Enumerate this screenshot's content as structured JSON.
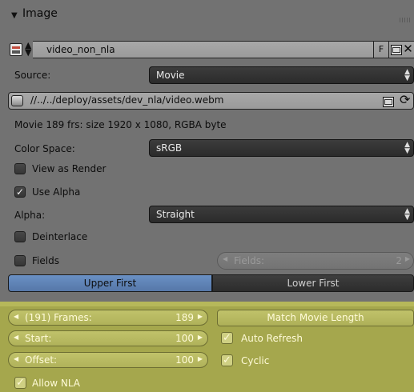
{
  "panel": {
    "arrow": "▼",
    "title": "Image"
  },
  "image_id": {
    "name": "video_non_nla",
    "fake_user_label": "F",
    "updown": "◆",
    "close_glyph": "✕"
  },
  "source": {
    "label": "Source:",
    "value": "Movie"
  },
  "filepath": {
    "value": "//../../deploy/assets/dev_nla/video.webm",
    "reload_glyph": "⟳"
  },
  "info": {
    "text": "Movie 189 frs: size 1920 x 1080, RGBA byte"
  },
  "color_space": {
    "label": "Color Space:",
    "value": "sRGB"
  },
  "view_as_render": {
    "label": "View as Render",
    "checked": false
  },
  "use_alpha": {
    "label": "Use Alpha",
    "checked": true
  },
  "alpha": {
    "label": "Alpha:",
    "value": "Straight"
  },
  "deinterlace": {
    "label": "Deinterlace",
    "checked": false
  },
  "fields": {
    "label": "Fields",
    "checked": false,
    "slider_label": "Fields:",
    "slider_value": "2"
  },
  "field_order": {
    "upper": "Upper First",
    "lower": "Lower First",
    "selected": "upper"
  },
  "frames": {
    "label": "(191) Frames:",
    "value": "189"
  },
  "match_length": {
    "label": "Match Movie Length"
  },
  "start": {
    "label": "Start:",
    "value": "100"
  },
  "offset": {
    "label": "Offset:",
    "value": "100"
  },
  "auto_refresh": {
    "label": "Auto Refresh",
    "checked": true
  },
  "cyclic": {
    "label": "Cyclic",
    "checked": true
  },
  "allow_nla": {
    "label": "Allow NLA",
    "checked": true
  },
  "glyphs": {
    "check": "✓",
    "left_arrow": "◀",
    "right_arrow": "▶",
    "dd_arrows": "▲▼"
  },
  "colors": {
    "panel_bg": "#727272",
    "olive_bg": "#a5a74d",
    "selected_blue": "#6a90c4"
  }
}
